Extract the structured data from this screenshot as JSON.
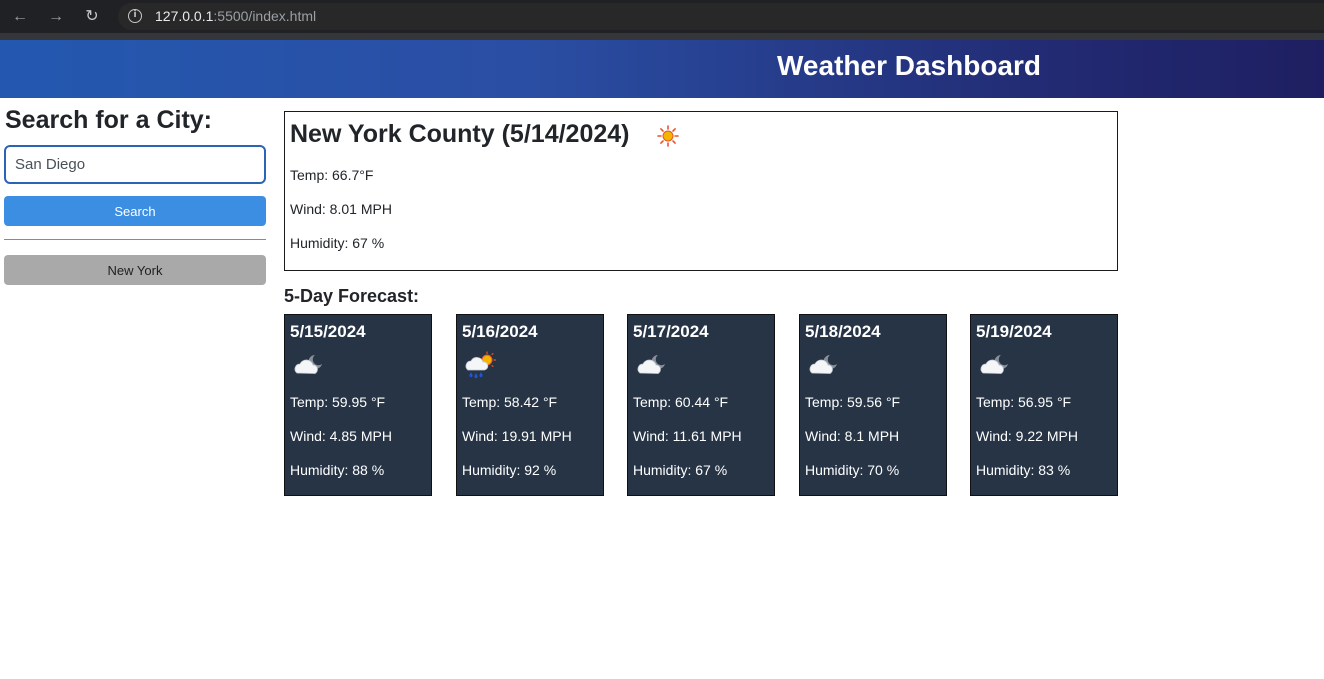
{
  "browser": {
    "url_host": "127.0.0.1",
    "url_path": ":5500/index.html"
  },
  "header": {
    "title": "Weather Dashboard"
  },
  "search": {
    "heading": "Search for a City:",
    "input_value": "San Diego",
    "button_label": "Search"
  },
  "history": {
    "items": [
      "New York"
    ]
  },
  "current": {
    "title": "New York County (5/14/2024)",
    "icon": "sun-icon",
    "temp": "Temp: 66.7°F",
    "wind": "Wind: 8.01 MPH",
    "humidity": "Humidity: 67 %"
  },
  "forecast": {
    "heading": "5-Day Forecast:",
    "days": [
      {
        "date": "5/15/2024",
        "icon": "cloud-moon-icon",
        "temp": "Temp: 59.95 °F",
        "wind": "Wind: 4.85 MPH",
        "humidity": "Humidity: 88 %"
      },
      {
        "date": "5/16/2024",
        "icon": "rain-sun-icon",
        "temp": "Temp: 58.42 °F",
        "wind": "Wind: 19.91 MPH",
        "humidity": "Humidity: 92 %"
      },
      {
        "date": "5/17/2024",
        "icon": "cloud-moon-icon",
        "temp": "Temp: 60.44 °F",
        "wind": "Wind: 11.61 MPH",
        "humidity": "Humidity: 67 %"
      },
      {
        "date": "5/18/2024",
        "icon": "cloud-moon-icon",
        "temp": "Temp: 59.56 °F",
        "wind": "Wind: 8.1 MPH",
        "humidity": "Humidity: 70 %"
      },
      {
        "date": "5/19/2024",
        "icon": "cloud-moon-icon",
        "temp": "Temp: 56.95 °F",
        "wind": "Wind: 9.22 MPH",
        "humidity": "Humidity: 83 %"
      }
    ]
  }
}
